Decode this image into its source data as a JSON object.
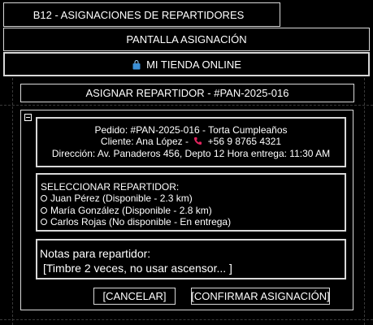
{
  "header": {
    "title": "B12 - ASIGNACIONES DE REPARTIDORES",
    "screen_name": "PANTALLA ASIGNACIÓN",
    "store_icon": "shopping-bag-icon",
    "store_name": "MI TIENDA ONLINE"
  },
  "assign": {
    "title": "ASIGNAR REPARTIDOR - #PAN-2025-016"
  },
  "order": {
    "line1": "Pedido: #PAN-2025-016 - Torta Cumpleaños",
    "client_label": "Cliente: Ana López -",
    "phone_icon": "phone-icon",
    "phone": "+56 9 8765 4321",
    "line3": "Dirección: Av. Panaderos 456, Depto 12 Hora entrega: 11:30 AM"
  },
  "selector": {
    "label": "SELECCIONAR REPARTIDOR:",
    "options": [
      "Juan Pérez (Disponible - 2.3 km)",
      "María González (Disponible - 2.8 km)",
      "Carlos Rojas (No disponible - En entrega)"
    ]
  },
  "notes": {
    "label": "Notas para repartidor:",
    "value": "[Timbre 2 veces, no usar ascensor... ]"
  },
  "actions": {
    "cancel": "[CANCELAR]",
    "confirm": "[CONFIRMAR ASIGNACIÓN]"
  },
  "colors": {
    "background": "#000000",
    "border": "#d8d8d8",
    "text": "#ffffff",
    "store_icon": "#3b8fd6",
    "phone_icon": "#e0245e"
  }
}
